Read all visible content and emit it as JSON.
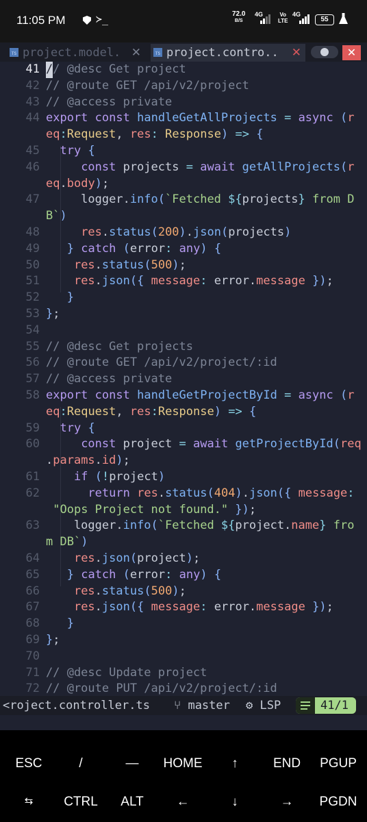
{
  "status_bar": {
    "time": "11:05 PM",
    "term_glyph": "≻_",
    "speed": "72.0",
    "speed_unit": "B/S",
    "sig1": "4G",
    "volte_top": "Vo",
    "volte_bottom": "LTE",
    "sig2": "4G",
    "battery": "55"
  },
  "tabs": [
    {
      "icon_text": "TS",
      "label": "project.model.",
      "close": "✕",
      "active": false
    },
    {
      "icon_text": "TS",
      "label": "project.contro..",
      "close": "✕",
      "active": true
    }
  ],
  "window_close": "✕",
  "cursor_line": "41",
  "lines": [
    {
      "n": "41",
      "t": [
        [
          "cur",
          "/"
        ],
        [
          "cm",
          "/ @desc Get project"
        ]
      ]
    },
    {
      "n": "42",
      "t": [
        [
          "cm",
          "// @route GET /api/v2/project"
        ]
      ]
    },
    {
      "n": "43",
      "t": [
        [
          "cm",
          "// @access private"
        ]
      ]
    },
    {
      "n": "44",
      "t": [
        [
          "kw",
          "export"
        ],
        [
          "id",
          " "
        ],
        [
          "kw",
          "const"
        ],
        [
          "id",
          " "
        ],
        [
          "fn",
          "handleGetAllProjects"
        ],
        [
          "id",
          " "
        ],
        [
          "op",
          "="
        ],
        [
          "id",
          " "
        ],
        [
          "kw",
          "async"
        ],
        [
          "id",
          " "
        ],
        [
          "pu",
          "("
        ],
        [
          "pr",
          "r"
        ]
      ]
    },
    {
      "n": "",
      "t": [
        [
          "pr",
          "eq"
        ],
        [
          "op",
          ":"
        ],
        [
          "ty",
          "Request"
        ],
        [
          "id",
          ", "
        ],
        [
          "pr",
          "res"
        ],
        [
          "op",
          ":"
        ],
        [
          "id",
          " "
        ],
        [
          "ty",
          "Response"
        ],
        [
          "pu",
          ")"
        ],
        [
          "id",
          " "
        ],
        [
          "op",
          "=>"
        ],
        [
          "id",
          " "
        ],
        [
          "pu",
          "{"
        ]
      ]
    },
    {
      "n": "45",
      "t": [
        [
          "id",
          "  "
        ],
        [
          "kw",
          "try"
        ],
        [
          "id",
          " "
        ],
        [
          "pu",
          "{"
        ]
      ]
    },
    {
      "n": "46",
      "t": [
        [
          "id",
          "     "
        ],
        [
          "kw",
          "const"
        ],
        [
          "id",
          " projects "
        ],
        [
          "op",
          "="
        ],
        [
          "id",
          " "
        ],
        [
          "kw",
          "await"
        ],
        [
          "id",
          " "
        ],
        [
          "fn",
          "getAllProjects"
        ],
        [
          "pu",
          "("
        ],
        [
          "pr",
          "r"
        ]
      ]
    },
    {
      "n": "",
      "t": [
        [
          "pr",
          "eq"
        ],
        [
          "id",
          "."
        ],
        [
          "pr",
          "body"
        ],
        [
          "pu",
          ")"
        ],
        [
          "id",
          ";"
        ]
      ]
    },
    {
      "n": "47",
      "t": [
        [
          "id",
          "     logger."
        ],
        [
          "fn",
          "info"
        ],
        [
          "pu",
          "("
        ],
        [
          "st",
          "`Fetched "
        ],
        [
          "op",
          "${"
        ],
        [
          "id",
          "projects"
        ],
        [
          "op",
          "}"
        ],
        [
          "st",
          " from D"
        ]
      ]
    },
    {
      "n": "",
      "t": [
        [
          "st",
          "B`"
        ],
        [
          "pu",
          ")"
        ]
      ]
    },
    {
      "n": "48",
      "t": [
        [
          "id",
          "     "
        ],
        [
          "pr",
          "res"
        ],
        [
          "id",
          "."
        ],
        [
          "fn",
          "status"
        ],
        [
          "pu",
          "("
        ],
        [
          "nu",
          "200"
        ],
        [
          "pu",
          ")"
        ],
        [
          "id",
          "."
        ],
        [
          "fn",
          "json"
        ],
        [
          "pu",
          "("
        ],
        [
          "id",
          "projects"
        ],
        [
          "pu",
          ")"
        ]
      ]
    },
    {
      "n": "49",
      "t": [
        [
          "id",
          "   "
        ],
        [
          "pu",
          "}"
        ],
        [
          "id",
          " "
        ],
        [
          "kw",
          "catch"
        ],
        [
          "id",
          " "
        ],
        [
          "pu",
          "("
        ],
        [
          "id",
          "error"
        ],
        [
          "op",
          ":"
        ],
        [
          "id",
          " "
        ],
        [
          "kw",
          "any"
        ],
        [
          "pu",
          ")"
        ],
        [
          "id",
          " "
        ],
        [
          "pu",
          "{"
        ]
      ]
    },
    {
      "n": "50",
      "t": [
        [
          "id",
          "    "
        ],
        [
          "pr",
          "res"
        ],
        [
          "id",
          "."
        ],
        [
          "fn",
          "status"
        ],
        [
          "pu",
          "("
        ],
        [
          "nu",
          "500"
        ],
        [
          "pu",
          ")"
        ],
        [
          "id",
          ";"
        ]
      ]
    },
    {
      "n": "51",
      "t": [
        [
          "id",
          "    "
        ],
        [
          "pr",
          "res"
        ],
        [
          "id",
          "."
        ],
        [
          "fn",
          "json"
        ],
        [
          "pu",
          "({"
        ],
        [
          "id",
          " "
        ],
        [
          "pr",
          "message"
        ],
        [
          "op",
          ":"
        ],
        [
          "id",
          " error."
        ],
        [
          "pr",
          "message"
        ],
        [
          "id",
          " "
        ],
        [
          "pu",
          "})"
        ],
        [
          "id",
          ";"
        ]
      ]
    },
    {
      "n": "52",
      "t": [
        [
          "id",
          "   "
        ],
        [
          "pu",
          "}"
        ]
      ]
    },
    {
      "n": "53",
      "t": [
        [
          "pu",
          "}"
        ],
        [
          "id",
          ";"
        ]
      ]
    },
    {
      "n": "54",
      "t": []
    },
    {
      "n": "55",
      "t": [
        [
          "cm",
          "// @desc Get projects"
        ]
      ]
    },
    {
      "n": "56",
      "t": [
        [
          "cm",
          "// @route GET /api/v2/project/:id"
        ]
      ]
    },
    {
      "n": "57",
      "t": [
        [
          "cm",
          "// @access private"
        ]
      ]
    },
    {
      "n": "58",
      "t": [
        [
          "kw",
          "export"
        ],
        [
          "id",
          " "
        ],
        [
          "kw",
          "const"
        ],
        [
          "id",
          " "
        ],
        [
          "fn",
          "handleGetProjectById"
        ],
        [
          "id",
          " "
        ],
        [
          "op",
          "="
        ],
        [
          "id",
          " "
        ],
        [
          "kw",
          "async"
        ],
        [
          "id",
          " "
        ],
        [
          "pu",
          "("
        ],
        [
          "pr",
          "r"
        ]
      ]
    },
    {
      "n": "",
      "t": [
        [
          "pr",
          "eq"
        ],
        [
          "op",
          ":"
        ],
        [
          "ty",
          "Request"
        ],
        [
          "id",
          ", "
        ],
        [
          "pr",
          "res"
        ],
        [
          "op",
          ":"
        ],
        [
          "ty",
          "Response"
        ],
        [
          "pu",
          ")"
        ],
        [
          "id",
          " "
        ],
        [
          "op",
          "=>"
        ],
        [
          "id",
          " "
        ],
        [
          "pu",
          "{"
        ]
      ]
    },
    {
      "n": "59",
      "t": [
        [
          "id",
          "  "
        ],
        [
          "kw",
          "try"
        ],
        [
          "id",
          " "
        ],
        [
          "pu",
          "{"
        ]
      ]
    },
    {
      "n": "60",
      "t": [
        [
          "id",
          "     "
        ],
        [
          "kw",
          "const"
        ],
        [
          "id",
          " project "
        ],
        [
          "op",
          "="
        ],
        [
          "id",
          " "
        ],
        [
          "kw",
          "await"
        ],
        [
          "id",
          " "
        ],
        [
          "fn",
          "getProjectById"
        ],
        [
          "pu",
          "("
        ],
        [
          "pr",
          "req"
        ]
      ]
    },
    {
      "n": "",
      "t": [
        [
          "id",
          "."
        ],
        [
          "pr",
          "params"
        ],
        [
          "id",
          "."
        ],
        [
          "pr",
          "id"
        ],
        [
          "pu",
          ")"
        ],
        [
          "id",
          ";"
        ]
      ]
    },
    {
      "n": "61",
      "t": [
        [
          "id",
          "    "
        ],
        [
          "kw",
          "if"
        ],
        [
          "id",
          " "
        ],
        [
          "pu",
          "("
        ],
        [
          "op",
          "!"
        ],
        [
          "id",
          "project"
        ],
        [
          "pu",
          ")"
        ]
      ]
    },
    {
      "n": "62",
      "t": [
        [
          "id",
          "      "
        ],
        [
          "kw",
          "return"
        ],
        [
          "id",
          " "
        ],
        [
          "pr",
          "res"
        ],
        [
          "id",
          "."
        ],
        [
          "fn",
          "status"
        ],
        [
          "pu",
          "("
        ],
        [
          "nu",
          "404"
        ],
        [
          "pu",
          ")"
        ],
        [
          "id",
          "."
        ],
        [
          "fn",
          "json"
        ],
        [
          "pu",
          "({"
        ],
        [
          "id",
          " "
        ],
        [
          "pr",
          "message"
        ],
        [
          "op",
          ":"
        ]
      ]
    },
    {
      "n": "",
      "t": [
        [
          "id",
          " "
        ],
        [
          "st",
          "\"Oops Project not found.\""
        ],
        [
          "id",
          " "
        ],
        [
          "pu",
          "})"
        ],
        [
          "id",
          ";"
        ]
      ]
    },
    {
      "n": "63",
      "t": [
        [
          "id",
          "    logger."
        ],
        [
          "fn",
          "info"
        ],
        [
          "pu",
          "("
        ],
        [
          "st",
          "`Fetched "
        ],
        [
          "op",
          "${"
        ],
        [
          "id",
          "project."
        ],
        [
          "pr",
          "name"
        ],
        [
          "op",
          "}"
        ],
        [
          "st",
          " fro"
        ]
      ]
    },
    {
      "n": "",
      "t": [
        [
          "st",
          "m DB`"
        ],
        [
          "pu",
          ")"
        ]
      ]
    },
    {
      "n": "64",
      "t": [
        [
          "id",
          "    "
        ],
        [
          "pr",
          "res"
        ],
        [
          "id",
          "."
        ],
        [
          "fn",
          "json"
        ],
        [
          "pu",
          "("
        ],
        [
          "id",
          "project"
        ],
        [
          "pu",
          ")"
        ],
        [
          "id",
          ";"
        ]
      ]
    },
    {
      "n": "65",
      "t": [
        [
          "id",
          "   "
        ],
        [
          "pu",
          "}"
        ],
        [
          "id",
          " "
        ],
        [
          "kw",
          "catch"
        ],
        [
          "id",
          " "
        ],
        [
          "pu",
          "("
        ],
        [
          "id",
          "error"
        ],
        [
          "op",
          ":"
        ],
        [
          "id",
          " "
        ],
        [
          "kw",
          "any"
        ],
        [
          "pu",
          ")"
        ],
        [
          "id",
          " "
        ],
        [
          "pu",
          "{"
        ]
      ]
    },
    {
      "n": "66",
      "t": [
        [
          "id",
          "    "
        ],
        [
          "pr",
          "res"
        ],
        [
          "id",
          "."
        ],
        [
          "fn",
          "status"
        ],
        [
          "pu",
          "("
        ],
        [
          "nu",
          "500"
        ],
        [
          "pu",
          ")"
        ],
        [
          "id",
          ";"
        ]
      ]
    },
    {
      "n": "67",
      "t": [
        [
          "id",
          "    "
        ],
        [
          "pr",
          "res"
        ],
        [
          "id",
          "."
        ],
        [
          "fn",
          "json"
        ],
        [
          "pu",
          "({"
        ],
        [
          "id",
          " "
        ],
        [
          "pr",
          "message"
        ],
        [
          "op",
          ":"
        ],
        [
          "id",
          " error."
        ],
        [
          "pr",
          "message"
        ],
        [
          "id",
          " "
        ],
        [
          "pu",
          "})"
        ],
        [
          "id",
          ";"
        ]
      ]
    },
    {
      "n": "68",
      "t": [
        [
          "id",
          "   "
        ],
        [
          "pu",
          "}"
        ]
      ]
    },
    {
      "n": "69",
      "t": [
        [
          "pu",
          "}"
        ],
        [
          "id",
          ";"
        ]
      ]
    },
    {
      "n": "70",
      "t": []
    },
    {
      "n": "71",
      "t": [
        [
          "cm",
          "// @desc Update project"
        ]
      ]
    },
    {
      "n": "72",
      "t": [
        [
          "cm",
          "// @route PUT /api/v2/project/:id"
        ]
      ]
    }
  ],
  "statusline": {
    "file": "<roject.controller.ts",
    "branch_icon": "⑂",
    "branch": "master",
    "lsp_icon": "⚙",
    "lsp": "LSP",
    "position": "41/1"
  },
  "keys_row1": [
    "ESC",
    "/",
    "—",
    "HOME",
    "↑",
    "END",
    "PGUP"
  ],
  "keys_row2": [
    "⇆",
    "CTRL",
    "ALT",
    "←",
    "↓",
    "→",
    "PGDN"
  ],
  "colors": {
    "editor_bg": "#1f2230",
    "comment": "#7d8596",
    "keyword": "#b69bf1",
    "function": "#7fb3f4",
    "property": "#f08d88",
    "type": "#e8cc8a",
    "string": "#a7d38c",
    "number": "#f0a871",
    "mode_badge": "#a6d88a"
  }
}
